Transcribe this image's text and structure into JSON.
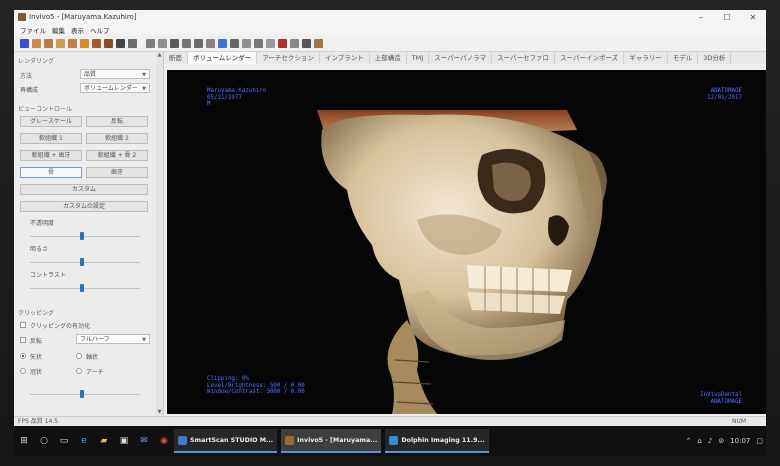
{
  "window": {
    "title": "Invivo5 - [Maruyama.Kazuhiro]",
    "controls": [
      "–",
      "☐",
      "✕"
    ]
  },
  "menu": [
    "ファイル",
    "編集",
    "表示",
    "ヘルプ"
  ],
  "tabs": [
    {
      "label": "断面",
      "active": false
    },
    {
      "label": "ボリュームレンダー",
      "active": true
    },
    {
      "label": "アーチセクション",
      "active": false
    },
    {
      "label": "インプラント",
      "active": false
    },
    {
      "label": "上部構造",
      "active": false
    },
    {
      "label": "TMJ",
      "active": false
    },
    {
      "label": "スーパーパノラマ",
      "active": false
    },
    {
      "label": "スーパーセファロ",
      "active": false
    },
    {
      "label": "スーパーインポーズ",
      "active": false
    },
    {
      "label": "ギャラリー",
      "active": false
    },
    {
      "label": "モデル",
      "active": false
    },
    {
      "label": "3D分析",
      "active": false
    }
  ],
  "panel": {
    "rendering_header": "レンダリング",
    "method_label": "方法",
    "method_value": "品質",
    "display_label": "再構成",
    "display_value": "ボリュームレンダー",
    "view_header": "ビューコントロール",
    "buttons": [
      "グレースケール",
      "反転",
      "軟組織 1",
      "軟組織 2",
      "軟組織 + 歯牙",
      "軟組織 + 骨 2",
      "骨",
      "歯牙"
    ],
    "custom_button": "カスタム",
    "custom_settings_button": "カスタムの設定",
    "slider1_label": "不透明度",
    "slider2_label": "明るさ",
    "slider3_label": "コントラスト",
    "clipping_header": "クリッピング",
    "clipping_enable": "クリッピングの有効化",
    "invert_label": "反転",
    "invert_value": "フルハーフ",
    "radio_options": [
      "矢状",
      "軸状",
      "冠状",
      "アーチ"
    ]
  },
  "overlay": {
    "patient_name": "Maruyama.Kazuhiro",
    "dob": "05/31/1977",
    "sex": "M",
    "brand": "ANATOMAGE",
    "date": "12/01/2017",
    "clipping": "Clipping:   0%",
    "level": "Level/Brightness:   500 / 0.00",
    "window": "Window/Contrast:   3000 / 0.00",
    "footer_brand_1": "InVivoDental",
    "footer_brand_2": "ANATOMAGE"
  },
  "status": {
    "left": "FPS 品質 14.5",
    "right": "NUM"
  },
  "taskbar": {
    "apps": [
      {
        "label": "SmartScan STUDIO M...",
        "active": false
      },
      {
        "label": "Invivo5 - [Maruyama...",
        "active": true
      },
      {
        "label": "Dolphin Imaging 11.9...",
        "active": false
      }
    ],
    "time": "10:07"
  },
  "colors": {
    "viewport_bg": "#060606",
    "overlay_text": "#5a6cff",
    "taskbar_bg": "#101010",
    "slider_thumb": "#2f6fc0"
  }
}
